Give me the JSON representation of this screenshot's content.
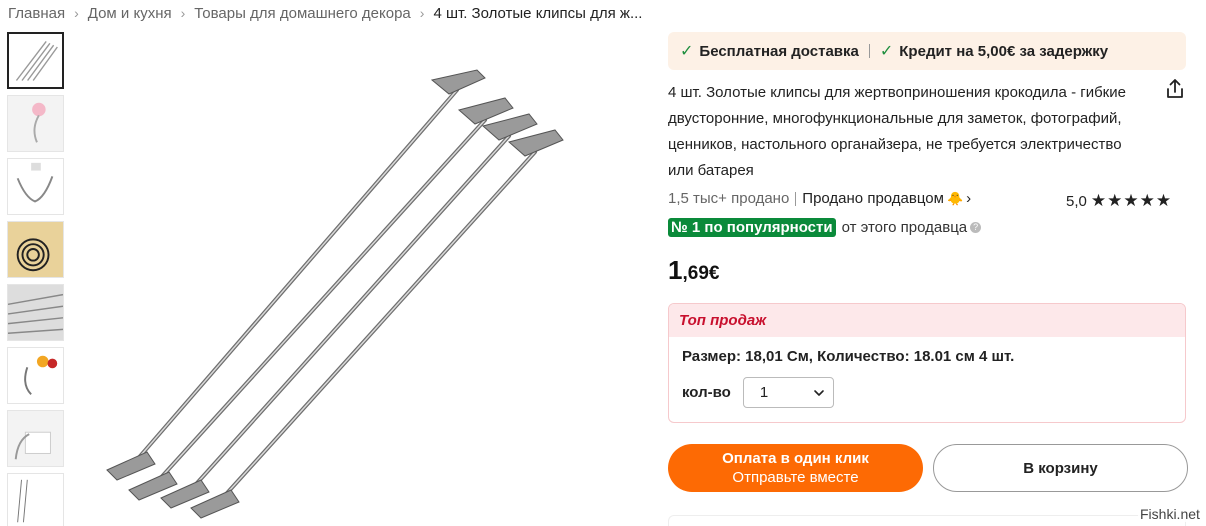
{
  "breadcrumb": {
    "items": [
      "Главная",
      "Дом и кухня",
      "Товары для домашнего декора",
      "4 шт. Золотые клипсы для ж..."
    ]
  },
  "gallery": {
    "thumbnail_count": 8,
    "active_index": 0
  },
  "delivery": {
    "free_shipping": "Бесплатная доставка",
    "credit": "Кредит на 5,00€ за задержку"
  },
  "product": {
    "title": "4 шт. Золотые клипсы для жертвоприношения крокодила - гибкие двусторонние, многофункциональные для заметок, фотографий, ценников, настольного органайзера, не требуется электричество или батарея",
    "sold": "1,5 тыс+ продано",
    "seller_text": "Продано продавцом",
    "rating": "5,0",
    "stars": 5,
    "popularity_badge": "№ 1 по популярности",
    "popularity_suffix": "от этого продавца",
    "price_int": "1",
    "price_frac": ",69€"
  },
  "sku": {
    "top_sales": "Топ продаж",
    "size_line": "Размер: 18,01 См, Количество: 18.01 см 4 шт.",
    "qty_label": "кол-во",
    "qty_value": "1"
  },
  "actions": {
    "buy_line1": "Оплата в один клик",
    "buy_line2": "Отправьте вместе",
    "cart": "В корзину"
  },
  "watermark": "Fishki.net",
  "colors": {
    "accent_orange": "#fd6a04",
    "badge_green": "#0a8a3a",
    "top_sales_red": "#c8102e",
    "delivery_bg": "#fdf1e6"
  },
  "icons": {
    "check": "check-icon",
    "share": "share-icon",
    "chevron": "chevron-down-icon",
    "info": "info-icon"
  }
}
